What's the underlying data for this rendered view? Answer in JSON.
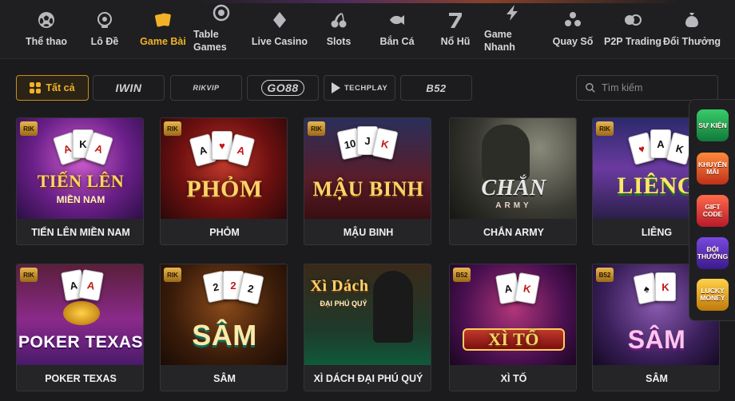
{
  "nav": {
    "items": [
      {
        "label": "Thể thao",
        "icon": "soccer-ball-icon"
      },
      {
        "label": "Lô Đề",
        "icon": "lottery-ball-icon"
      },
      {
        "label": "Game Bài",
        "icon": "playing-cards-icon"
      },
      {
        "label": "Table Games",
        "icon": "casino-chip-icon"
      },
      {
        "label": "Live Casino",
        "icon": "diamond-suit-icon"
      },
      {
        "label": "Slots",
        "icon": "cherry-icon"
      },
      {
        "label": "Bắn Cá",
        "icon": "fish-icon"
      },
      {
        "label": "Nổ Hũ",
        "icon": "number-seven-icon"
      },
      {
        "label": "Game Nhanh",
        "icon": "lightning-icon"
      },
      {
        "label": "Quay Số",
        "icon": "balls-icon"
      },
      {
        "label": "P2P Trading",
        "icon": "p2p-icon"
      },
      {
        "label": "Đổi Thưởng",
        "icon": "money-bag-icon"
      }
    ],
    "active": "Game Bài"
  },
  "filters": {
    "all_label": "Tất cả",
    "providers": [
      "IWIN",
      "RIKVIP",
      "GO88",
      "TECHPLAY",
      "B52"
    ]
  },
  "search": {
    "placeholder": "Tìm kiếm"
  },
  "games": [
    {
      "title": "TIẾN LÊN MIỀN NAM",
      "logo": "TIẾN LÊN",
      "logo_sub": "MIỀN NAM",
      "provider": "RIK"
    },
    {
      "title": "PHỎM",
      "logo": "PHỎM",
      "logo_sub": "",
      "provider": "RIK"
    },
    {
      "title": "MẬU BINH",
      "logo": "MẬU BINH",
      "logo_sub": "",
      "provider": "RIK"
    },
    {
      "title": "CHẮN ARMY",
      "logo": "CHẮN",
      "logo_sub": "ARMY",
      "provider": ""
    },
    {
      "title": "LIÊNG",
      "logo": "LIÊNG",
      "logo_sub": "",
      "provider": "RIK"
    },
    {
      "title": "POKER TEXAS",
      "logo": "POKER TEXAS",
      "logo_sub": "",
      "provider": "RIK"
    },
    {
      "title": "SÂM",
      "logo": "SÂM",
      "logo_sub": "",
      "provider": "RIK"
    },
    {
      "title": "XÌ DÁCH ĐẠI PHÚ QUÝ",
      "logo": "Xì Dách",
      "logo_sub": "ĐẠI PHÚ QUÝ",
      "provider": ""
    },
    {
      "title": "XÌ TỐ",
      "logo": "XÌ TỐ",
      "logo_sub": "",
      "provider": "B52"
    },
    {
      "title": "SÂM",
      "logo": "SÂM",
      "logo_sub": "",
      "provider": "B52"
    }
  ],
  "side_promos": [
    {
      "label": "SỰ KIỆN",
      "icon": "event-icon"
    },
    {
      "label": "KHUYẾN MÃI",
      "icon": "promotion-icon"
    },
    {
      "label": "GIFT CODE",
      "icon": "gift-code-icon"
    },
    {
      "label": "ĐỔI THƯỞNG",
      "icon": "reward-icon"
    },
    {
      "label": "LUCKY MONEY",
      "icon": "lucky-money-icon"
    }
  ],
  "colors": {
    "accent": "#f2b227",
    "background": "#1b1b1d",
    "card": "#242427"
  }
}
